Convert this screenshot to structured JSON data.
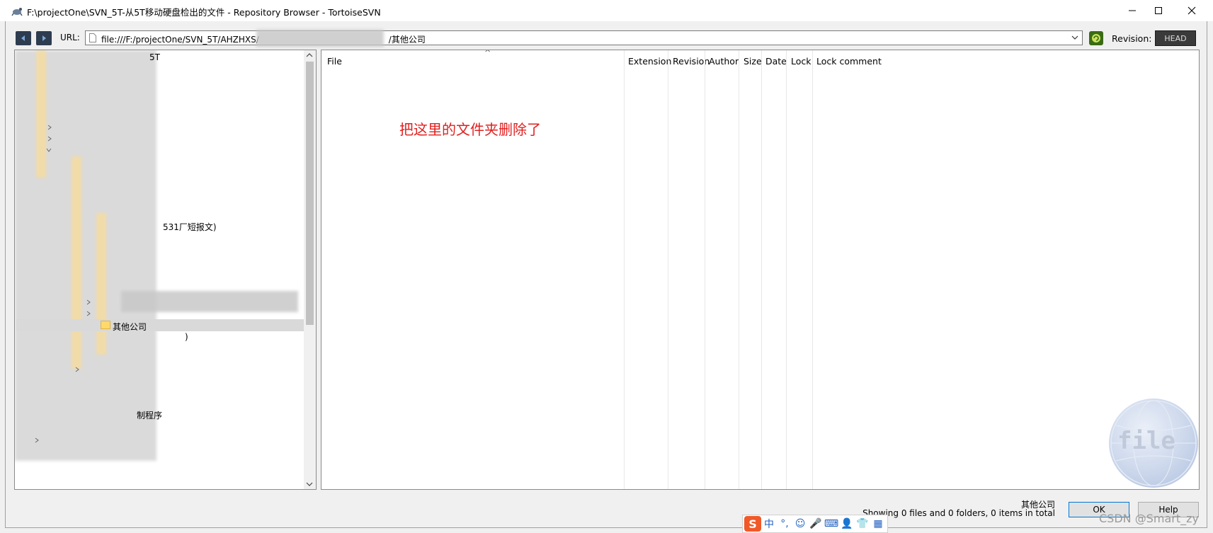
{
  "window": {
    "title": "F:\\projectOne\\SVN_5T-从5T移动硬盘检出的文件 - Repository Browser - TortoiseSVN",
    "controls": {
      "minimize": "minimize",
      "maximize": "maximize",
      "close": "close"
    }
  },
  "toolbar": {
    "url_label": "URL:",
    "url_value": "file:///F:/projectOne/SVN_5T/AHZHXS/",
    "url_suffix": "/其他公司",
    "revision_label": "Revision:",
    "revision_value": "HEAD"
  },
  "tree": {
    "items": [
      {
        "label": "5T"
      },
      {
        "label": "531厂短报文)"
      },
      {
        "label": "其他公司",
        "selected": true
      },
      {
        "label": ")"
      },
      {
        "label": "制程序"
      }
    ]
  },
  "list": {
    "columns": [
      "File",
      "Extension",
      "Revision",
      "Author",
      "Size",
      "Date",
      "Lock",
      "Lock comment"
    ],
    "rows": []
  },
  "annotation": {
    "text": "把这里的文件夹删除了",
    "color": "#e02020"
  },
  "watermark": {
    "text": "file"
  },
  "status": {
    "path": "其他公司",
    "summary": "Showing 0 files and 0 folders, 0 items in total"
  },
  "buttons": {
    "ok": "OK",
    "help": "Help"
  },
  "credit": "CSDN @Smart_zy",
  "ime": {
    "logo": "S",
    "items": [
      "中",
      "°,",
      "☺",
      "🎤",
      "⌨",
      "👤",
      "👕",
      "▦"
    ]
  }
}
